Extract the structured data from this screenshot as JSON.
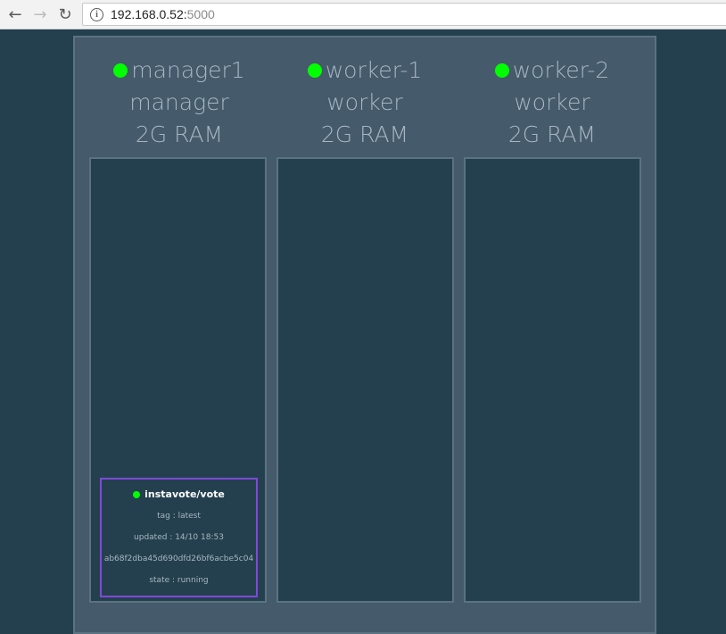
{
  "browser": {
    "back_icon": "←",
    "forward_icon": "→",
    "reload_icon": "↻",
    "info_icon": "i",
    "url_host": "192.168.0.52:",
    "url_port": "5000"
  },
  "colors": {
    "status_ok": "#00ff00",
    "task_border": "#7f4ad8"
  },
  "nodes": [
    {
      "name": "manager1",
      "role": "manager",
      "ram": "2G RAM",
      "status": "ready"
    },
    {
      "name": "worker-1",
      "role": "worker",
      "ram": "2G RAM",
      "status": "ready"
    },
    {
      "name": "worker-2",
      "role": "worker",
      "ram": "2G RAM",
      "status": "ready"
    }
  ],
  "task": {
    "name": "instavote/vote",
    "tag": "tag : latest",
    "updated": "updated : 14/10 18:53",
    "id": "ab68f2dba45d690dfd26bf6acbe5c04",
    "state": "state : running"
  }
}
